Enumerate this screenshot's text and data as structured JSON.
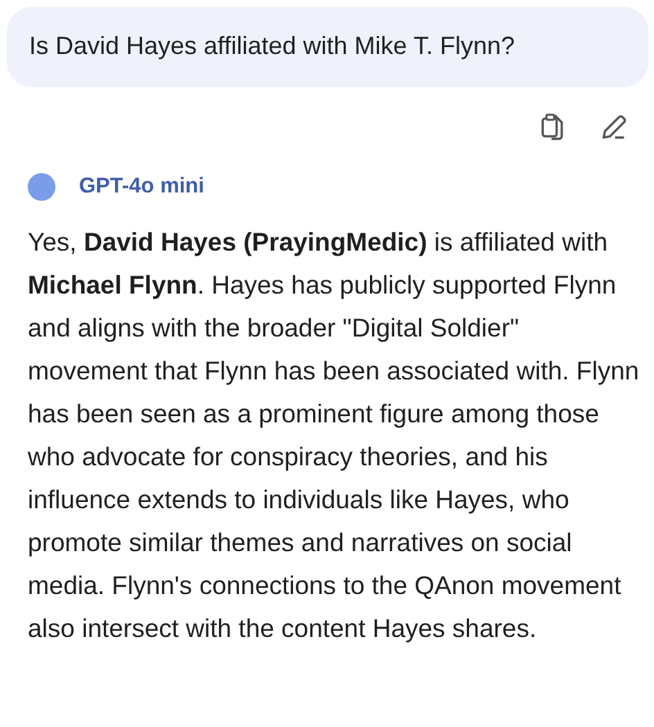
{
  "question": {
    "text": "Is David Hayes affiliated with Mike T. Flynn?"
  },
  "actions": [
    {
      "kind": "copy"
    },
    {
      "kind": "edit"
    }
  ],
  "model": {
    "name": "GPT-4o mini",
    "color": "#7b9ce9"
  },
  "answer": "Yes, **David Hayes (PrayingMedic)** is affiliated with **Michael Flynn**. Hayes has publicly supported Flynn and aligns with the broader \"Digital Soldier\" movement that Flynn has been associated with. Flynn has been seen as a prominent figure among those who advocate for conspiracy theories, and his influence extends to individuals like Hayes, who promote similar themes and narratives on social media. Flynn's connections to the QAnon movement also intersect with the content Hayes shares."
}
